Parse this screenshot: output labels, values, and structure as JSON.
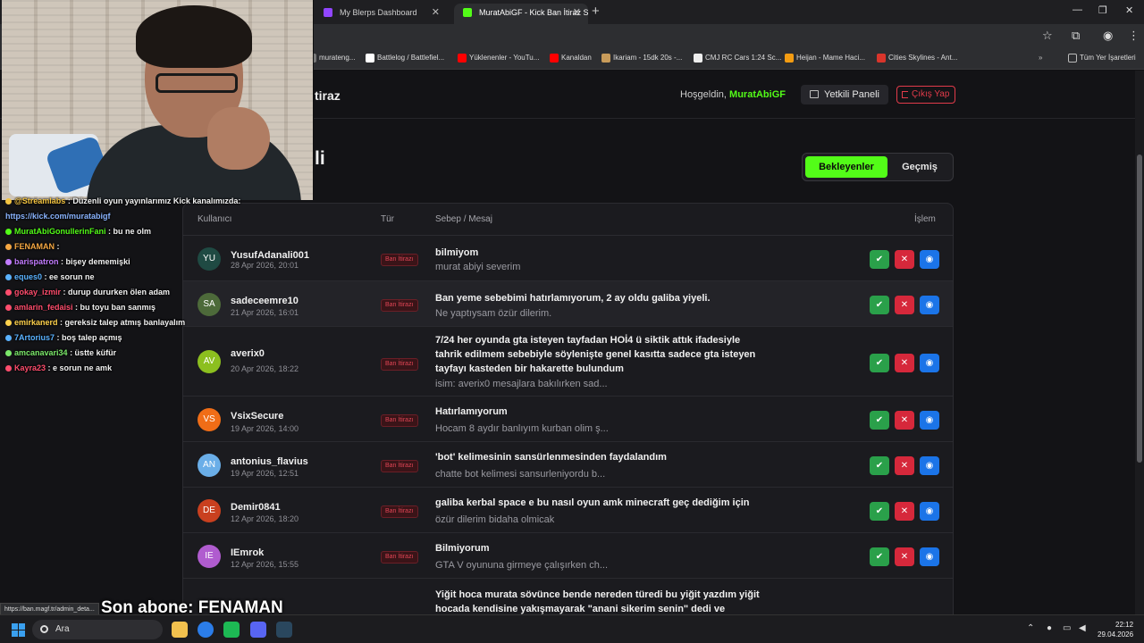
{
  "browser": {
    "tabs": [
      {
        "label": "My Blerps Dashboard",
        "color": "#9146ff"
      },
      {
        "label": "MuratAbiGF - Kick Ban İtiraz Sis",
        "color": "#53fc18"
      }
    ],
    "bookmarks": [
      {
        "label": "murateng...",
        "color": "#777"
      },
      {
        "label": "Battlelog / Battlefiel...",
        "color": "#ffffff"
      },
      {
        "label": "Yüklenenler - YouTu...",
        "color": "#ff0000"
      },
      {
        "label": "Kanaldan",
        "color": "#ff0000"
      },
      {
        "label": "Ikariam - 15dk 20s -...",
        "color": "#c89b5a"
      },
      {
        "label": "CMJ RC Cars 1:24 Sc...",
        "color": "#eeeeee"
      },
      {
        "label": "Heijan - Mame Haci...",
        "color": "#f39c12"
      },
      {
        "label": "Cities Skylines - Ant...",
        "color": "#d9352b"
      },
      {
        "label": "Tüm Yer İşaretleri",
        "color": "#999"
      }
    ]
  },
  "header": {
    "site_title": "tiraz",
    "welcome_prefix": "Hoşgeldin,",
    "username": "MuratAbiGF",
    "panel_label": "Yetkili Paneli",
    "logout_label": "Çıkış Yap"
  },
  "section": {
    "title": "li",
    "filter_pending": "Bekleyenler",
    "filter_history": "Geçmiş"
  },
  "table": {
    "columns": {
      "user": "Kullanıcı",
      "type": "Tür",
      "reason": "Sebep / Mesaj",
      "actions": "İşlem"
    },
    "rows": [
      {
        "initials": "YU",
        "color": "#1f4a43",
        "user": "YusufAdanali001",
        "date": "28 Apr 2026, 20:01",
        "type": "Ban İtirazı",
        "reason": "bilmiyom",
        "message": "murat abiyi severim"
      },
      {
        "initials": "SA",
        "color": "#4d6a3a",
        "user": "sadeceemre10",
        "date": "21 Apr 2026, 16:01",
        "type": "Ban İtirazı",
        "reason": "Ban yeme sebebimi hatırlamıyorum, 2 ay oldu galiba yiyeli.",
        "message": "Ne yaptıysam özür dilerim."
      },
      {
        "initials": "AV",
        "color": "#8cbf1f",
        "user": "averix0",
        "date": "20 Apr 2026, 18:22",
        "type": "Ban İtirazı",
        "reason": "7/24 her oyunda gta isteyen tayfadan HOİ4 ü siktik attık ifadesiyle tahrik edilmem sebebiyle söylenişte genel kasıtta sadece gta isteyen tayfayı kasteden bir hakarette bulundum",
        "message": "isim: averix0 mesajlara bakılırken sad..."
      },
      {
        "initials": "VS",
        "color": "#f06d17",
        "user": "VsixSecure",
        "date": "19 Apr 2026, 14:00",
        "type": "Ban İtirazı",
        "reason": "Hatırlamıyorum",
        "message": "Hocam 8 aydır banlıyım kurban olim ş..."
      },
      {
        "initials": "AN",
        "color": "#6aaee8",
        "user": "antonius_flavius",
        "date": "19 Apr 2026, 12:51",
        "type": "Ban İtirazı",
        "reason": "'bot' kelimesinin sansürlenmesinden faydalandım",
        "message": "chatte bot kelimesi sansurleniyordu b..."
      },
      {
        "initials": "DE",
        "color": "#c9401f",
        "user": "Demir0841",
        "date": "12 Apr 2026, 18:20",
        "type": "Ban İtirazı",
        "reason": "galiba kerbal space e bu nasıl oyun amk minecraft geç dediğim için",
        "message": "özür dilerim bidaha olmicak"
      },
      {
        "initials": "IE",
        "color": "#b05ccf",
        "user": "IEmrok",
        "date": "12 Apr 2026, 15:55",
        "type": "Ban İtirazı",
        "reason": "Bilmiyorum",
        "message": "GTA V oyununa girmeye çalışırken ch..."
      },
      {
        "initials": "",
        "color": "#1b1b1f",
        "user": "",
        "date": "",
        "type": "",
        "reason": "Yiğit hoca murata sövünce bende nereden türedi bu yiğit yazdım yiğit hocada kendisine yakışmayarak \"anani sikerim senin\" dedi ve",
        "message": ""
      }
    ]
  },
  "chat": [
    {
      "user": "@Streamlabs",
      "color": "#f5c542",
      "text": ": Düzenli oyun yayınlarımız Kick kanalımızda:"
    },
    {
      "user": "",
      "color": "#8ab4ff",
      "text": "https://kick.com/muratabigf"
    },
    {
      "user": "MuratAbiGonullerinFani",
      "color": "#53fc18",
      "text": ": bu ne olm"
    },
    {
      "user": "FENAMAN",
      "color": "#f5a742",
      "text": ":"
    },
    {
      "user": "barispatron",
      "color": "#c27cff",
      "text": ": bişey dememişki"
    },
    {
      "user": "eques0",
      "color": "#5ab2ff",
      "text": ": ee sorun ne"
    },
    {
      "user": "gokay_izmir",
      "color": "#ff4d6d",
      "text": ": durup dururken ölen adam"
    },
    {
      "user": "amlarin_fedaisi",
      "color": "#ff4d6d",
      "text": ": bu toyu ban sanmış"
    },
    {
      "user": "emirkanerd",
      "color": "#ffd24d",
      "text": ": gereksiz talep atmış banlayalım"
    },
    {
      "user": "7Artorius7",
      "color": "#5ab2ff",
      "text": ": boş talep açmış"
    },
    {
      "user": "amcanavari34",
      "color": "#7be86a",
      "text": ": üstte küfür"
    },
    {
      "user": "Kayra23",
      "color": "#ff4d6d",
      "text": ": e sorun ne amk"
    }
  ],
  "overlay": {
    "last_sub": "Son abone: FENAMAN",
    "status_url": "https://ban.magf.tr/admin_deta..."
  },
  "taskbar": {
    "search_label": "Ara",
    "time": "22:12",
    "date": "29.04.2026"
  }
}
